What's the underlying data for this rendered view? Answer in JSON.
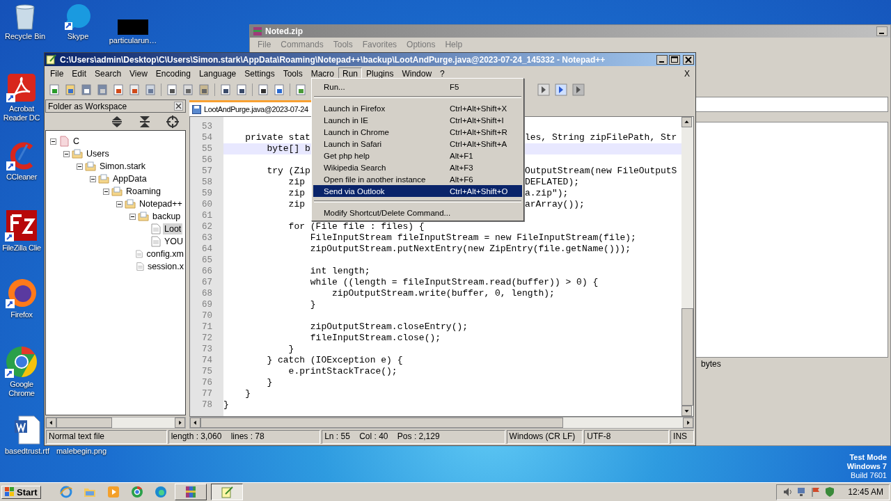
{
  "desktop": {
    "top_icons": [
      {
        "label": "Recycle Bin",
        "kind": "trash"
      },
      {
        "label": "Skype",
        "kind": "chat"
      },
      {
        "label": "particularun…",
        "kind": "redacted"
      }
    ],
    "side_icons": [
      {
        "label": "Acrobat Reader DC",
        "kind": "pdf"
      },
      {
        "label": "CCleaner",
        "kind": "cleaner"
      },
      {
        "label": "FileZilla Clie",
        "kind": "ftp"
      },
      {
        "label": "Firefox",
        "kind": "firefox"
      },
      {
        "label": "Google Chrome",
        "kind": "chrome"
      }
    ],
    "bottom_icons": [
      {
        "label": "basedtrust.rtf",
        "kind": "word"
      },
      {
        "label": "malebegin.png",
        "kind": "hidden"
      }
    ],
    "os_notice": [
      "Test Mode",
      "Windows 7",
      "Build 7601"
    ]
  },
  "back_window": {
    "title": "Noted.zip",
    "menu": [
      "File",
      "Commands",
      "Tools",
      "Favorites",
      "Options",
      "Help"
    ],
    "status": "bytes"
  },
  "editor_window": {
    "title": "C:\\Users\\admin\\Desktop\\C\\Users\\Simon.stark\\AppData\\Roaming\\Notepad++\\backup\\LootAndPurge.java@2023-07-24_145332 - Notepad++",
    "menu": [
      {
        "label": "File",
        "selected": false
      },
      {
        "label": "Edit",
        "selected": false
      },
      {
        "label": "Search",
        "selected": false
      },
      {
        "label": "View",
        "selected": false
      },
      {
        "label": "Encoding",
        "selected": false
      },
      {
        "label": "Language",
        "selected": false
      },
      {
        "label": "Settings",
        "selected": false
      },
      {
        "label": "Tools",
        "selected": false
      },
      {
        "label": "Macro",
        "selected": false
      },
      {
        "label": "Run",
        "selected": true
      },
      {
        "label": "Plugins",
        "selected": false
      },
      {
        "label": "Window",
        "selected": false
      },
      {
        "label": "?",
        "selected": false
      }
    ],
    "close_doc": "X",
    "panel_title": "Folder as Workspace",
    "tree": [
      {
        "label": "C",
        "kind": "drive",
        "expanded": true,
        "selected": false,
        "children": [
          {
            "label": "Users",
            "kind": "folder",
            "expanded": true,
            "selected": false,
            "children": [
              {
                "label": "Simon.stark",
                "kind": "folder",
                "expanded": true,
                "selected": false,
                "children": [
                  {
                    "label": "AppData",
                    "kind": "folder",
                    "expanded": true,
                    "selected": false,
                    "children": [
                      {
                        "label": "Roaming",
                        "kind": "folder",
                        "expanded": true,
                        "selected": false,
                        "children": [
                          {
                            "label": "Notepad++",
                            "kind": "folder",
                            "expanded": true,
                            "selected": false,
                            "children": [
                              {
                                "label": "backup",
                                "kind": "folder",
                                "expanded": true,
                                "selected": false,
                                "children": [
                                  {
                                    "label": "Loot",
                                    "kind": "file",
                                    "selected": true
                                  },
                                  {
                                    "label": "YOU",
                                    "kind": "file",
                                    "selected": false
                                  }
                                ]
                              },
                              {
                                "label": "config.xm",
                                "kind": "file",
                                "selected": false
                              },
                              {
                                "label": "session.x",
                                "kind": "file",
                                "selected": false
                              }
                            ]
                          }
                        ]
                      }
                    ]
                  }
                ]
              }
            ]
          }
        ]
      }
    ],
    "tab": "LootAndPurge.java@2023-07-24",
    "code": [
      {
        "num": "53",
        "current": false
      },
      {
        "num": "54",
        "text": "    private stat",
        "tail": "les, String zipFilePath, Str",
        "current": false
      },
      {
        "num": "55",
        "text": "        byte[] b",
        "current": true
      },
      {
        "num": "56",
        "current": false
      },
      {
        "num": "57",
        "text": "        try (Zip",
        "tail": "OutputStream(new FileOutputS",
        "current": false
      },
      {
        "num": "58",
        "text": "            zip",
        "tail": "DEFLATED);",
        "current": false
      },
      {
        "num": "59",
        "text": "            zip",
        "tail": "a.zip\");",
        "current": false
      },
      {
        "num": "60",
        "text": "            zip",
        "tail": "arArray());",
        "current": false
      },
      {
        "num": "61",
        "current": false
      },
      {
        "num": "62",
        "text": "            for (File file : files) {",
        "current": false
      },
      {
        "num": "63",
        "text": "                FileInputStream fileInputStream = new FileInputStream(file);",
        "current": false
      },
      {
        "num": "64",
        "text": "                zipOutputStream.putNextEntry(new ZipEntry(file.getName()));",
        "current": false
      },
      {
        "num": "65",
        "current": false
      },
      {
        "num": "66",
        "text": "                int length;",
        "current": false
      },
      {
        "num": "67",
        "text": "                while ((length = fileInputStream.read(buffer)) > 0) {",
        "current": false
      },
      {
        "num": "68",
        "text": "                    zipOutputStream.write(buffer, 0, length);",
        "current": false
      },
      {
        "num": "69",
        "text": "                }",
        "current": false
      },
      {
        "num": "70",
        "current": false
      },
      {
        "num": "71",
        "text": "                zipOutputStream.closeEntry();",
        "current": false
      },
      {
        "num": "72",
        "text": "                fileInputStream.close();",
        "current": false
      },
      {
        "num": "73",
        "text": "            }",
        "current": false
      },
      {
        "num": "74",
        "text": "        } catch (IOException e) {",
        "current": false
      },
      {
        "num": "75",
        "text": "            e.printStackTrace();",
        "current": false
      },
      {
        "num": "76",
        "text": "        }",
        "current": false
      },
      {
        "num": "77",
        "text": "    }",
        "current": false
      },
      {
        "num": "78",
        "text": "}",
        "current": false
      }
    ],
    "run_menu": [
      {
        "kind": "item",
        "label": "Run...",
        "shortcut": "F5",
        "selected": false
      },
      {
        "kind": "separator"
      },
      {
        "kind": "item",
        "label": "Launch in Firefox",
        "shortcut": "Ctrl+Alt+Shift+X",
        "selected": false
      },
      {
        "kind": "item",
        "label": "Launch in IE",
        "shortcut": "Ctrl+Alt+Shift+I",
        "selected": false
      },
      {
        "kind": "item",
        "label": "Launch in Chrome",
        "shortcut": "Ctrl+Alt+Shift+R",
        "selected": false
      },
      {
        "kind": "item",
        "label": "Launch in Safari",
        "shortcut": "Ctrl+Alt+Shift+A",
        "selected": false
      },
      {
        "kind": "item",
        "label": "Get php help",
        "shortcut": "Alt+F1",
        "selected": false
      },
      {
        "kind": "item",
        "label": "Wikipedia Search",
        "shortcut": "Alt+F3",
        "selected": false
      },
      {
        "kind": "item",
        "label": "Open file in another instance",
        "shortcut": "Alt+F6",
        "selected": false
      },
      {
        "kind": "item",
        "label": "Send via Outlook",
        "shortcut": "Ctrl+Alt+Shift+O",
        "selected": true
      },
      {
        "kind": "separator"
      },
      {
        "kind": "item",
        "label": "Modify Shortcut/Delete Command...",
        "selected": false
      }
    ],
    "status": [
      "Normal text file",
      "length : 3,060    lines : 78",
      "Ln : 55    Col : 40    Pos : 2,129",
      "Windows (CR LF)",
      "UTF-8",
      "INS"
    ]
  },
  "taskbar": {
    "start": "Start",
    "tasks": [
      {
        "kind": "ie",
        "open": false,
        "selected": false
      },
      {
        "kind": "folder",
        "open": false,
        "selected": false
      },
      {
        "kind": "media",
        "open": false,
        "selected": false
      },
      {
        "kind": "chrome",
        "open": false,
        "selected": false
      },
      {
        "kind": "edge",
        "open": false,
        "selected": false
      },
      {
        "kind": "archive",
        "open": true,
        "selected": false
      },
      {
        "kind": "notepad",
        "open": true,
        "selected": true
      }
    ],
    "clock": "12:45 AM"
  }
}
